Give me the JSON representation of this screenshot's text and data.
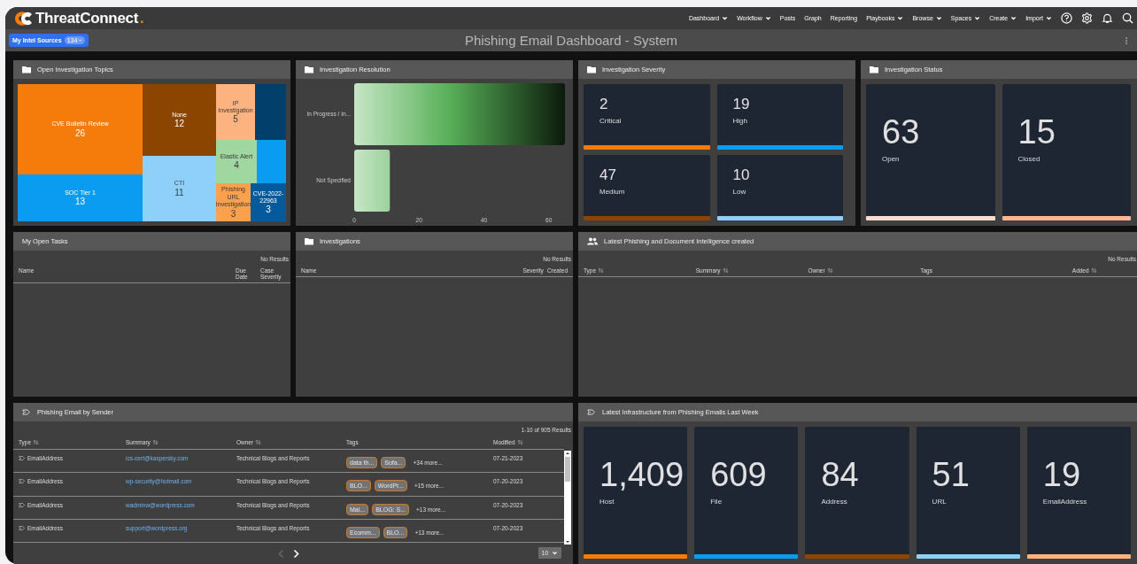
{
  "nav": {
    "brand": "ThreatConnect",
    "brand_mark": ".",
    "menu": [
      {
        "label": "Dashboard",
        "dropdown": true
      },
      {
        "label": "Workflow",
        "dropdown": true
      },
      {
        "label": "Posts",
        "dropdown": false
      },
      {
        "label": "Graph",
        "dropdown": false
      },
      {
        "label": "Reporting",
        "dropdown": false
      },
      {
        "label": "Playbooks",
        "dropdown": true
      },
      {
        "label": "Browse",
        "dropdown": true
      },
      {
        "label": "Spaces",
        "dropdown": true
      },
      {
        "label": "Create",
        "dropdown": true
      },
      {
        "label": "Import",
        "dropdown": true
      }
    ]
  },
  "title_bar": {
    "sources_button": "My Intel Sources",
    "sources_count": "134",
    "title": "Phishing Email Dashboard - System"
  },
  "panels": [
    {
      "kind": "treemap",
      "title": "Open Investigation Topics",
      "items": [
        {
          "label": "CVE Bulletin Review",
          "value": "26",
          "color": "#f57c0a"
        },
        {
          "label": "SOC Tier 1",
          "value": "13",
          "color": "#0a9cf0"
        },
        {
          "label": "None",
          "value": "12",
          "color": "#8b4500"
        },
        {
          "label": "CTI",
          "value": "11",
          "color": "#8fd0fa"
        },
        {
          "label": "IP Investigation",
          "value": "5",
          "color": "#fdb37f"
        },
        {
          "color": "#023f6b"
        },
        {
          "label": "Elastic Alert",
          "value": "4",
          "color": "#a0d6a0"
        },
        {
          "color": "#0a9cf0"
        },
        {
          "label": "Phishing URL Investigation",
          "value": "3",
          "color": "#fba04c"
        },
        {
          "label": "CVE-2022-22963",
          "value": "3",
          "color": "#045a9a"
        }
      ]
    },
    {
      "kind": "bar_chart",
      "title": "Investigation Resolution",
      "chart_data": {
        "type": "bar",
        "orientation": "horizontal",
        "categories": [
          "In Progress / In...",
          "Not Specified"
        ],
        "values": [
          65,
          11
        ],
        "xlim": [
          0,
          65
        ],
        "xticks": [
          0,
          20,
          40,
          60
        ]
      }
    },
    {
      "kind": "severity_tiles",
      "title": "Investigation Severity",
      "tiles": [
        {
          "value": "2",
          "label": "Critical",
          "color": "#f57c00"
        },
        {
          "value": "19",
          "label": "High",
          "color": "#0a9cf0"
        },
        {
          "value": "47",
          "label": "Medium",
          "color": "#8b4500"
        },
        {
          "value": "10",
          "label": "Low",
          "color": "#8fd0fa"
        }
      ]
    },
    {
      "kind": "stat_tiles",
      "title": "Investigation Status",
      "tiles": [
        {
          "value": "63",
          "label": "Open",
          "color": "#fdd9cf"
        },
        {
          "value": "15",
          "label": "Closed",
          "color": "#fbb596"
        }
      ]
    },
    {
      "kind": "empty_table",
      "title": "My Open Tasks",
      "results": "No Results",
      "columns": [
        {
          "label": "Name",
          "sortable": false
        },
        {
          "label": "Due Date",
          "sortable": false
        },
        {
          "label": "Case Severity",
          "sortable": false
        }
      ]
    },
    {
      "kind": "empty_table",
      "title": "Investigations",
      "results": "No Results",
      "columns": [
        {
          "label": "Name",
          "sortable": false
        },
        {
          "label": "Severity",
          "sortable": false
        },
        {
          "label": "Created",
          "sortable": false
        }
      ]
    },
    {
      "kind": "empty_table",
      "title": "Latest Phishing and Document Intelligence created",
      "results": "No Results",
      "columns": [
        {
          "label": "Type",
          "sortable": true
        },
        {
          "label": "Summary",
          "sortable": true
        },
        {
          "label": "Owner",
          "sortable": true
        },
        {
          "label": "Tags",
          "sortable": false
        },
        {
          "label": "Added",
          "sortable": true
        }
      ]
    },
    {
      "kind": "data_table",
      "title": "Phishing Email by Sender",
      "results": "1-10 of 905 Results",
      "columns": [
        {
          "label": "Type",
          "sortable": true
        },
        {
          "label": "Summary",
          "sortable": true
        },
        {
          "label": "Owner",
          "sortable": true
        },
        {
          "label": "Tags",
          "sortable": false
        },
        {
          "label": "Modified",
          "sortable": true
        }
      ],
      "rows": [
        {
          "type": "EmailAddress",
          "summary": "ics-cert@kaspersky.com",
          "owner": "Technical Blogs and Reports",
          "tags": [
            "data th...",
            "Sofa..."
          ],
          "more": "+34 more...",
          "modified": "07-21-2023"
        },
        {
          "type": "EmailAddress",
          "summary": "wp-security@hotmail.com",
          "owner": "Technical Blogs and Reports",
          "tags": [
            "BLO...",
            "WordPr..."
          ],
          "more": "+15 more...",
          "modified": "07-20-2023"
        },
        {
          "type": "EmailAddress",
          "summary": "wadminw@wordpress.com",
          "owner": "Technical Blogs and Reports",
          "tags": [
            "Mal...",
            "BLOG: S..."
          ],
          "more": "+13 more...",
          "modified": "07-20-2023"
        },
        {
          "type": "EmailAddress",
          "summary": "support@wordpress.org",
          "owner": "Technical Blogs and Reports",
          "tags": [
            "Ecomm...",
            "BLO..."
          ],
          "more": "+13 more...",
          "modified": "07-20-2023"
        }
      ],
      "pagination": {
        "prev_disabled": true,
        "next_disabled": false,
        "page_size": "10"
      }
    },
    {
      "kind": "stat_tiles",
      "title": "Latest Infrastructure from Phishing Emails Last Week",
      "tiles": [
        {
          "value": "1,409",
          "label": "Host",
          "color": "#f57c00"
        },
        {
          "value": "609",
          "label": "File",
          "color": "#0a9cf0"
        },
        {
          "value": "84",
          "label": "Address",
          "color": "#8b4500"
        },
        {
          "value": "51",
          "label": "URL",
          "color": "#8fd0fa"
        },
        {
          "value": "19",
          "label": "EmailAddress",
          "color": "#fdb37f"
        }
      ]
    }
  ]
}
